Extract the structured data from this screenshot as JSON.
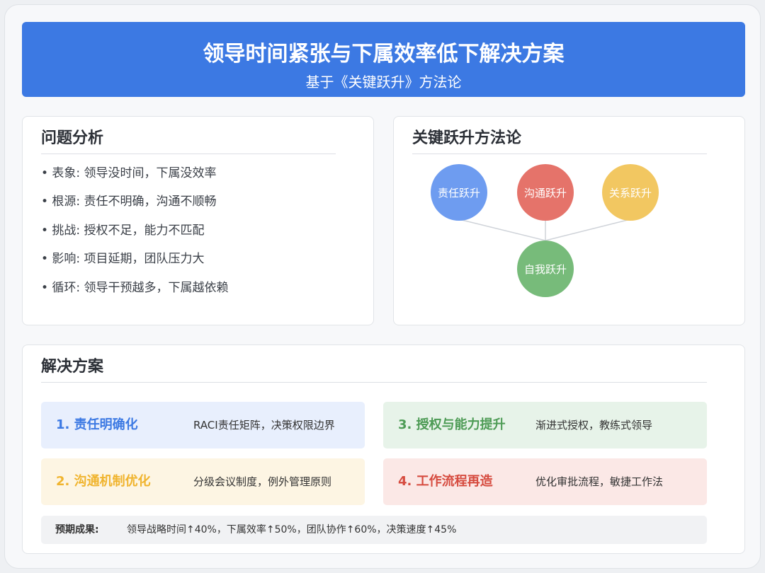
{
  "header": {
    "title": "领导时间紧张与下属效率低下解决方案",
    "subtitle": "基于《关键跃升》方法论"
  },
  "problem": {
    "title": "问题分析",
    "items": [
      "• 表象: 领导没时间，下属没效率",
      "• 根源: 责任不明确，沟通不顺畅",
      "• 挑战: 授权不足，能力不匹配",
      "• 影响: 项目延期，团队压力大",
      "• 循环: 领导干预越多，下属越依赖"
    ]
  },
  "method": {
    "title": "关键跃升方法论",
    "nodes": [
      {
        "label": "责任跃升",
        "color": "#6e9cf0"
      },
      {
        "label": "沟通跃升",
        "color": "#e5736a"
      },
      {
        "label": "关系跃升",
        "color": "#f2c761"
      },
      {
        "label": "自我跃升",
        "color": "#77bb7a"
      }
    ]
  },
  "solutions": {
    "title": "解决方案",
    "items": [
      {
        "title": "1. 责任明确化",
        "desc": "RACI责任矩阵，决策权限边界",
        "bg": "#e8effd",
        "color": "#3c79e3"
      },
      {
        "title": "3. 授权与能力提升",
        "desc": "渐进式授权，教练式领导",
        "bg": "#e7f3e9",
        "color": "#4d9b55"
      },
      {
        "title": "2. 沟通机制优化",
        "desc": "分级会议制度，例外管理原则",
        "bg": "#fdf5e3",
        "color": "#f0b42e"
      },
      {
        "title": "4. 工作流程再造",
        "desc": "优化审批流程，敏捷工作法",
        "bg": "#fbe8e6",
        "color": "#d64b3f"
      }
    ],
    "outcome_label": "预期成果:",
    "outcome_text": "领导战略时间↑40%，下属效率↑50%，团队协作↑60%，决策速度↑45%"
  }
}
